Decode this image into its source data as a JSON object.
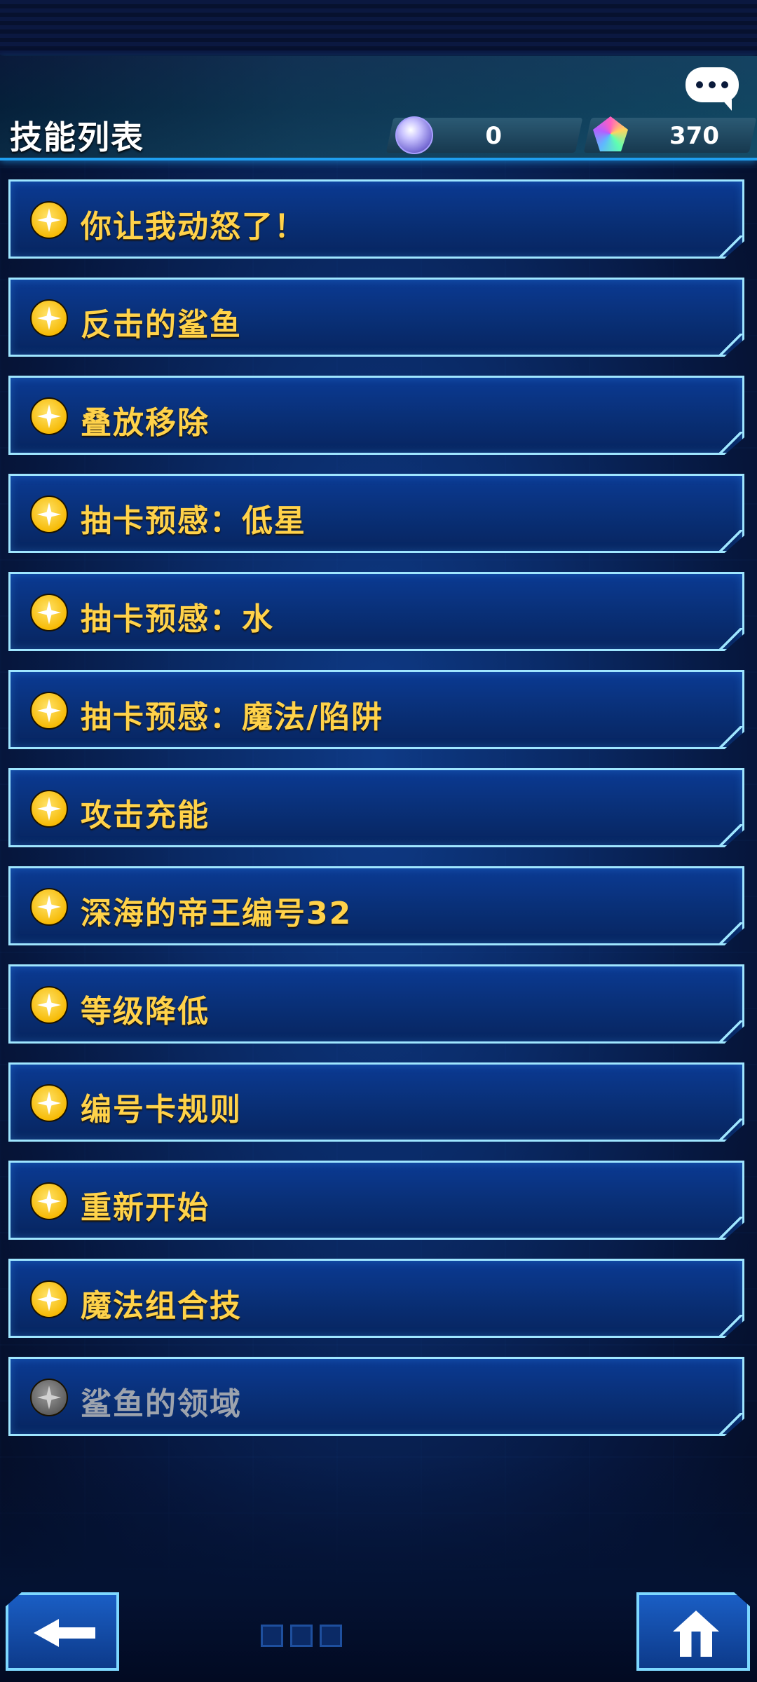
{
  "header": {
    "title": "技能列表",
    "currencies": [
      {
        "name": "orb",
        "icon": "orb-icon",
        "value": "0"
      },
      {
        "name": "gem",
        "icon": "gem-icon",
        "value": "370"
      }
    ],
    "chat_icon": "chat-bubble-icon"
  },
  "skills": [
    {
      "label": "你让我动怒了！",
      "state": "available"
    },
    {
      "label": "反击的鲨鱼",
      "state": "available"
    },
    {
      "label": "叠放移除",
      "state": "available"
    },
    {
      "label": "抽卡预感：低星",
      "state": "available"
    },
    {
      "label": "抽卡预感：水",
      "state": "available"
    },
    {
      "label": "抽卡预感：魔法/陷阱",
      "state": "available"
    },
    {
      "label": "攻击充能",
      "state": "available"
    },
    {
      "label": "深海的帝王编号32",
      "state": "available"
    },
    {
      "label": "等级降低",
      "state": "available"
    },
    {
      "label": "编号卡规则",
      "state": "available"
    },
    {
      "label": "重新开始",
      "state": "available"
    },
    {
      "label": "魔法组合技",
      "state": "available"
    },
    {
      "label": "鲨鱼的领域",
      "state": "locked"
    }
  ],
  "nav": {
    "back_icon": "back-arrow-icon",
    "home_icon": "home-icon"
  },
  "colors": {
    "accent": "#1f9ff0",
    "skill_text": "#ffd24a",
    "locked_text": "#9da3ad",
    "panel": "#093078"
  }
}
